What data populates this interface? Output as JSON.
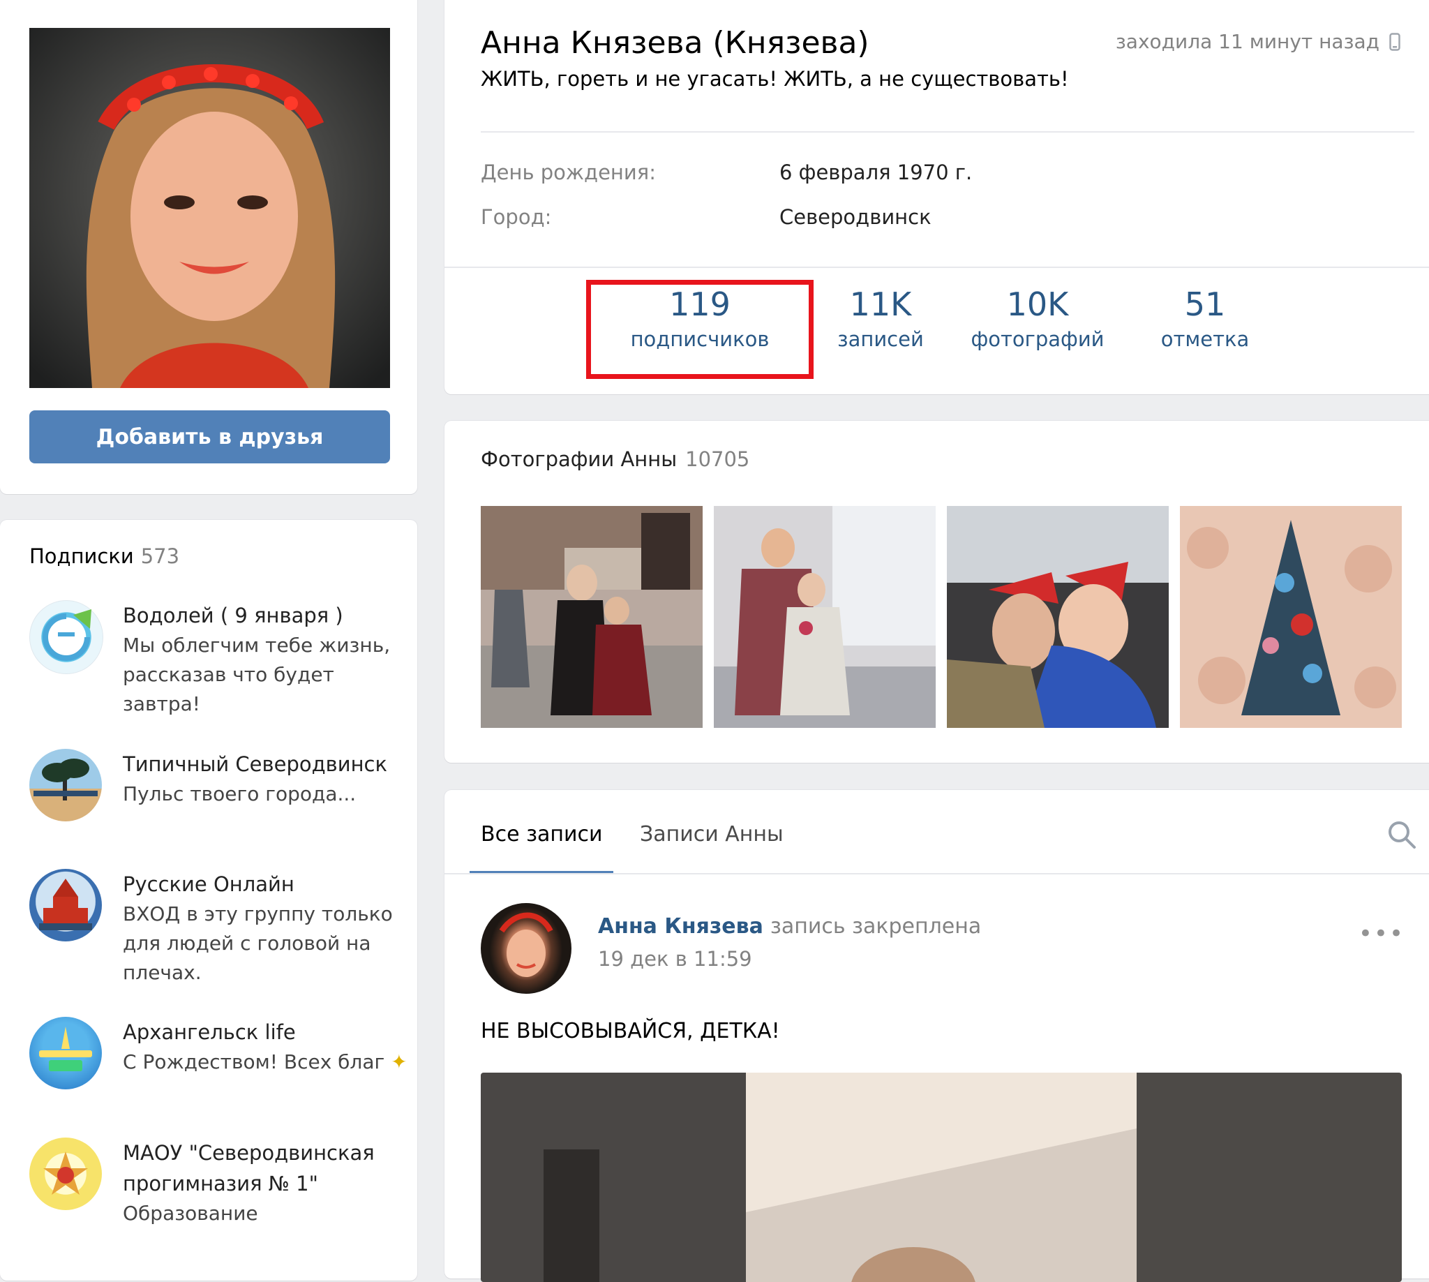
{
  "profile": {
    "name": "Анна Князева (Князева)",
    "status": "ЖИТЬ, гореть и не угасать! ЖИТЬ, а не существовать!",
    "last_seen": "заходила 11 минут назад",
    "add_friend_label": "Добавить в друзья",
    "info": [
      {
        "label": "День рождения:",
        "value": "6 февраля 1970 г."
      },
      {
        "label": "Город:",
        "value": "Северодвинск"
      }
    ],
    "counters": [
      {
        "value": "119",
        "label": "подписчиков"
      },
      {
        "value": "11K",
        "label": "записей"
      },
      {
        "value": "10K",
        "label": "фотографий"
      },
      {
        "value": "51",
        "label": "отметка"
      }
    ]
  },
  "subscriptions": {
    "title": "Подписки",
    "count": "573",
    "items": [
      {
        "name": "Водолей ( 9 января )",
        "desc": "Мы облегчим тебе жизнь, рассказав что будет завтра!"
      },
      {
        "name": "Типичный Северодвинск",
        "desc": "Пульс твоего города..."
      },
      {
        "name": "Русские Онлайн",
        "desc": "ВХОД в эту группу только для людей с головой на плечах."
      },
      {
        "name": "Архангельск life",
        "desc": "С Рождеством! Всех благ"
      },
      {
        "name": "МАОУ \"Северодвинская прогимназия № 1\"",
        "desc": "Образование"
      }
    ]
  },
  "photos": {
    "title": "Фотографии Анны",
    "count": "10705"
  },
  "wall": {
    "tabs": [
      "Все записи",
      "Записи Анны"
    ],
    "post": {
      "author": "Анна Князева",
      "pinned": "запись закреплена",
      "date": "19 дек в 11:59",
      "more": "•••",
      "text": "НЕ ВЫСОВЫВАЙСЯ, ДЕТКА!"
    }
  },
  "colors": {
    "accent": "#5181b8",
    "link": "#2a5885",
    "highlight": "#e8141c",
    "muted": "#828282",
    "background": "#edeef0"
  }
}
